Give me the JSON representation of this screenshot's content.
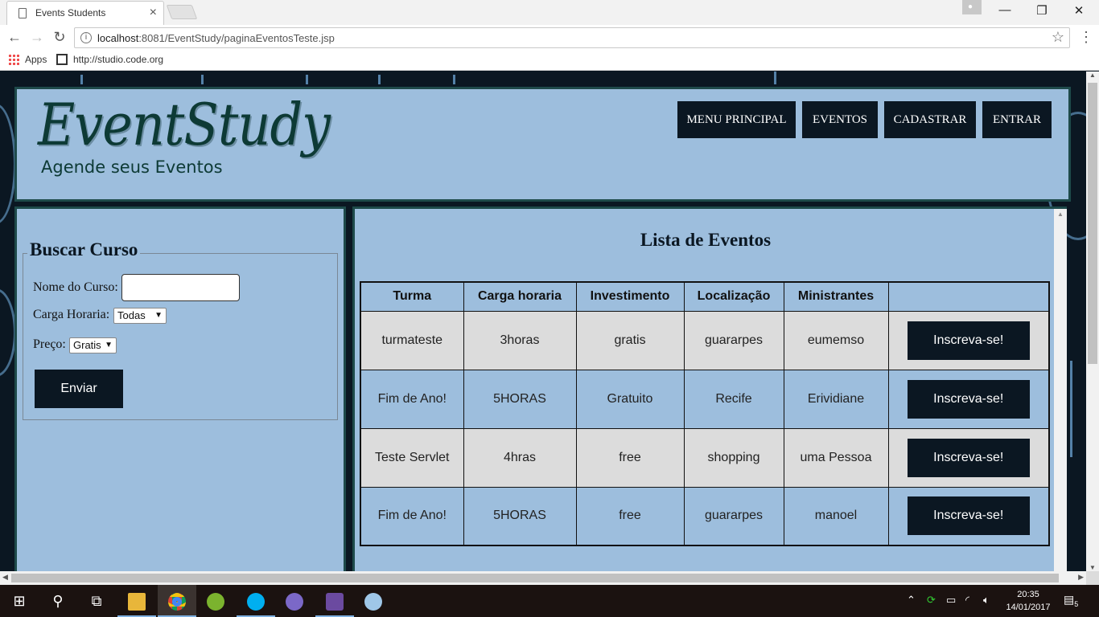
{
  "browser": {
    "tab_title": "Events Students",
    "tab_close": "×",
    "url_host": "localhost",
    "url_rest": ":8081/EventStudy/paginaEventosTeste.jsp",
    "bookmarks": [
      {
        "label": "Apps"
      },
      {
        "label": "http://studio.code.org"
      }
    ],
    "window_controls": {
      "minimize": "—",
      "maximize": "❐",
      "close": "✕"
    }
  },
  "site": {
    "logo_title": "EventStudy",
    "logo_subtitle": "Agende seus Eventos",
    "nav": [
      "MENU PRINCIPAL",
      "EVENTOS",
      "CADASTRAR",
      "ENTRAR"
    ]
  },
  "search": {
    "legend": "Buscar Curso",
    "course_name_label": "Nome do Curso:",
    "course_name_value": "",
    "hours_label": "Carga Horaria:",
    "hours_selected": "Todas",
    "price_label": "Preço:",
    "price_selected": "Gratis",
    "submit_label": "Enviar"
  },
  "events": {
    "title": "Lista de Eventos",
    "columns": [
      "Turma",
      "Carga horaria",
      "Investimento",
      "Localização",
      "Ministrantes",
      ""
    ],
    "rows": [
      {
        "turma": "turmateste",
        "carga": "3horas",
        "investimento": "gratis",
        "local": "guararpes",
        "ministrante": "eumemso",
        "action": "Inscreva-se!"
      },
      {
        "turma": "Fim de Ano!",
        "carga": "5HORAS",
        "investimento": "Gratuito",
        "local": "Recife",
        "ministrante": "Erividiane",
        "action": "Inscreva-se!"
      },
      {
        "turma": "Teste Servlet",
        "carga": "4hras",
        "investimento": "free",
        "local": "shopping",
        "ministrante": "uma Pessoa",
        "action": "Inscreva-se!"
      },
      {
        "turma": "Fim de Ano!",
        "carga": "5HORAS",
        "investimento": "free",
        "local": "guararpes",
        "ministrante": "manoel",
        "action": "Inscreva-se!"
      }
    ]
  },
  "taskbar": {
    "time": "20:35",
    "date": "14/01/2017",
    "notifications": "5"
  },
  "colors": {
    "page_background": "#0b1722",
    "panel": "#9dbedd",
    "panel_border": "#1e4a4a",
    "button": "#0b1722",
    "alt_row": "#dcdcdc"
  }
}
